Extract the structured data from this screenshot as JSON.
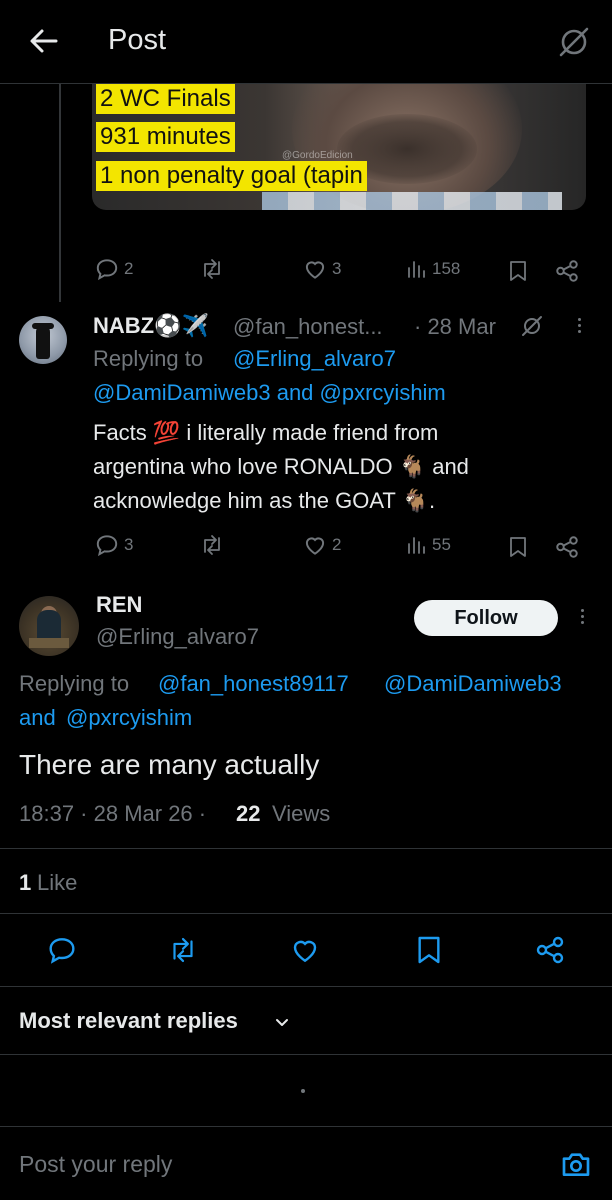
{
  "header": {
    "title": "Post"
  },
  "media": {
    "lines": [
      "2 WC Finals",
      "931 minutes",
      "1 non penalty goal (tapin"
    ],
    "watermark": "@GordoEdicion"
  },
  "first_post_actions": {
    "replies": "2",
    "reposts": "",
    "likes": "3",
    "views": "158"
  },
  "reply_post": {
    "name": "NABZ⚽✈️",
    "handle": "@fan_honest...",
    "time": "· 28 Mar",
    "replying_label": "Replying to",
    "replying_to_1": "@Erling_alvaro7",
    "replying_to_2": "@DamiDamiweb3 and @pxrcyishim",
    "text_line_1": "Facts 💯 i literally made friend from",
    "text_line_2": "argentina who love RONALDO 🐐 and",
    "text_line_3": "acknowledge him as the GOAT 🐐.",
    "actions": {
      "replies": "3",
      "likes": "2",
      "views": "55"
    }
  },
  "main_post": {
    "name": "REN",
    "handle": "@Erling_alvaro7",
    "follow_label": "Follow",
    "replying_label": "Replying to",
    "replying_to_1": "@fan_honest89117",
    "replying_to_2": "@DamiDamiweb3",
    "replying_and": "and",
    "replying_to_3": "@pxrcyishim",
    "text": "There are many actually",
    "time": "18:37 · 28 Mar 26 ·",
    "views_count": "22",
    "views_label": "Views",
    "likes_count": "1",
    "likes_label": "Like"
  },
  "sort": {
    "label": "Most relevant replies"
  },
  "composer": {
    "placeholder": "Post your reply"
  },
  "colors": {
    "accent": "#1d9bf0",
    "muted": "#71767b",
    "background": "#000000",
    "highlight": "#f3e500"
  }
}
